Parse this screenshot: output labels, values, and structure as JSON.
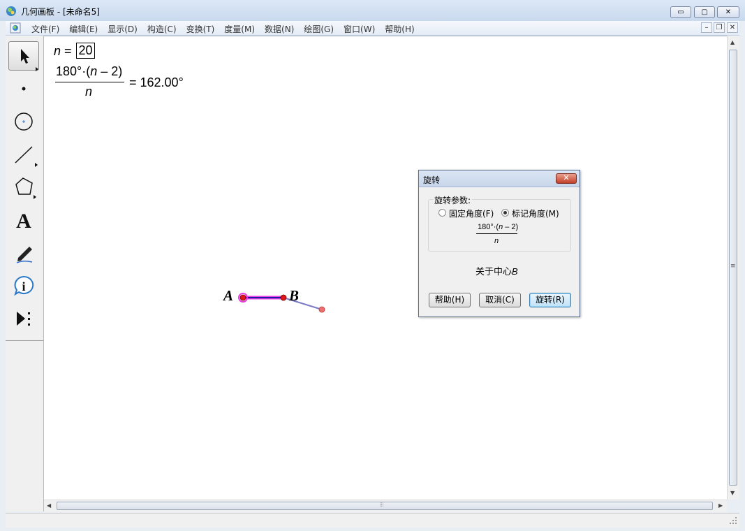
{
  "window": {
    "title": "几何画板 - [未命名5]",
    "controls": {
      "minimize": "▭",
      "maximize": "▢",
      "close": "✕"
    }
  },
  "menu": {
    "items": [
      "文件(F)",
      "编辑(E)",
      "显示(D)",
      "构造(C)",
      "变换(T)",
      "度量(M)",
      "数据(N)",
      "绘图(G)",
      "窗口(W)",
      "帮助(H)"
    ],
    "mdi": {
      "minimize": "–",
      "restore": "❐",
      "close": "✕"
    }
  },
  "toolbox": {
    "tools": [
      "arrow-select-icon",
      "point-icon",
      "compass-icon",
      "straightedge-icon",
      "polygon-icon",
      "text-icon",
      "marker-icon",
      "information-icon",
      "custom-tool-icon"
    ],
    "text_tool_glyph": "A"
  },
  "canvas": {
    "parameter": {
      "name": "n",
      "equals": "=",
      "value": "20"
    },
    "calculation": {
      "numerator_lead": "180°·(",
      "numerator_var": "n",
      "numerator_tail": " – 2)",
      "denominator": "n",
      "result": "= 162.00°"
    },
    "points": {
      "A": "A",
      "B": "B"
    }
  },
  "dialog": {
    "title": "旋转",
    "close": "✕",
    "group_label": "旋转参数:",
    "options": [
      {
        "label": "固定角度(F)",
        "selected": false
      },
      {
        "label": "标记角度(M)",
        "selected": true
      }
    ],
    "angle": {
      "numerator_lead": "180°·(",
      "numerator_var": "n",
      "numerator_tail": " – 2)",
      "denominator": "n"
    },
    "center_text": "关于中心",
    "center_point": "B",
    "buttons": {
      "help": "帮助(H)",
      "cancel": "取消(C)",
      "rotate": "旋转(R)"
    }
  },
  "scroll": {
    "grip": "≡",
    "hgrip": "⦙⦙⦙",
    "up": "▲",
    "down": "▼",
    "left": "◀",
    "right": "▶"
  },
  "colors": {
    "segment": "#1a1aa8",
    "point": "#e0161b",
    "highlight": "#e83ce0",
    "rotated_segment": "#7b7bc8",
    "rotated_point": "#ef7070"
  }
}
